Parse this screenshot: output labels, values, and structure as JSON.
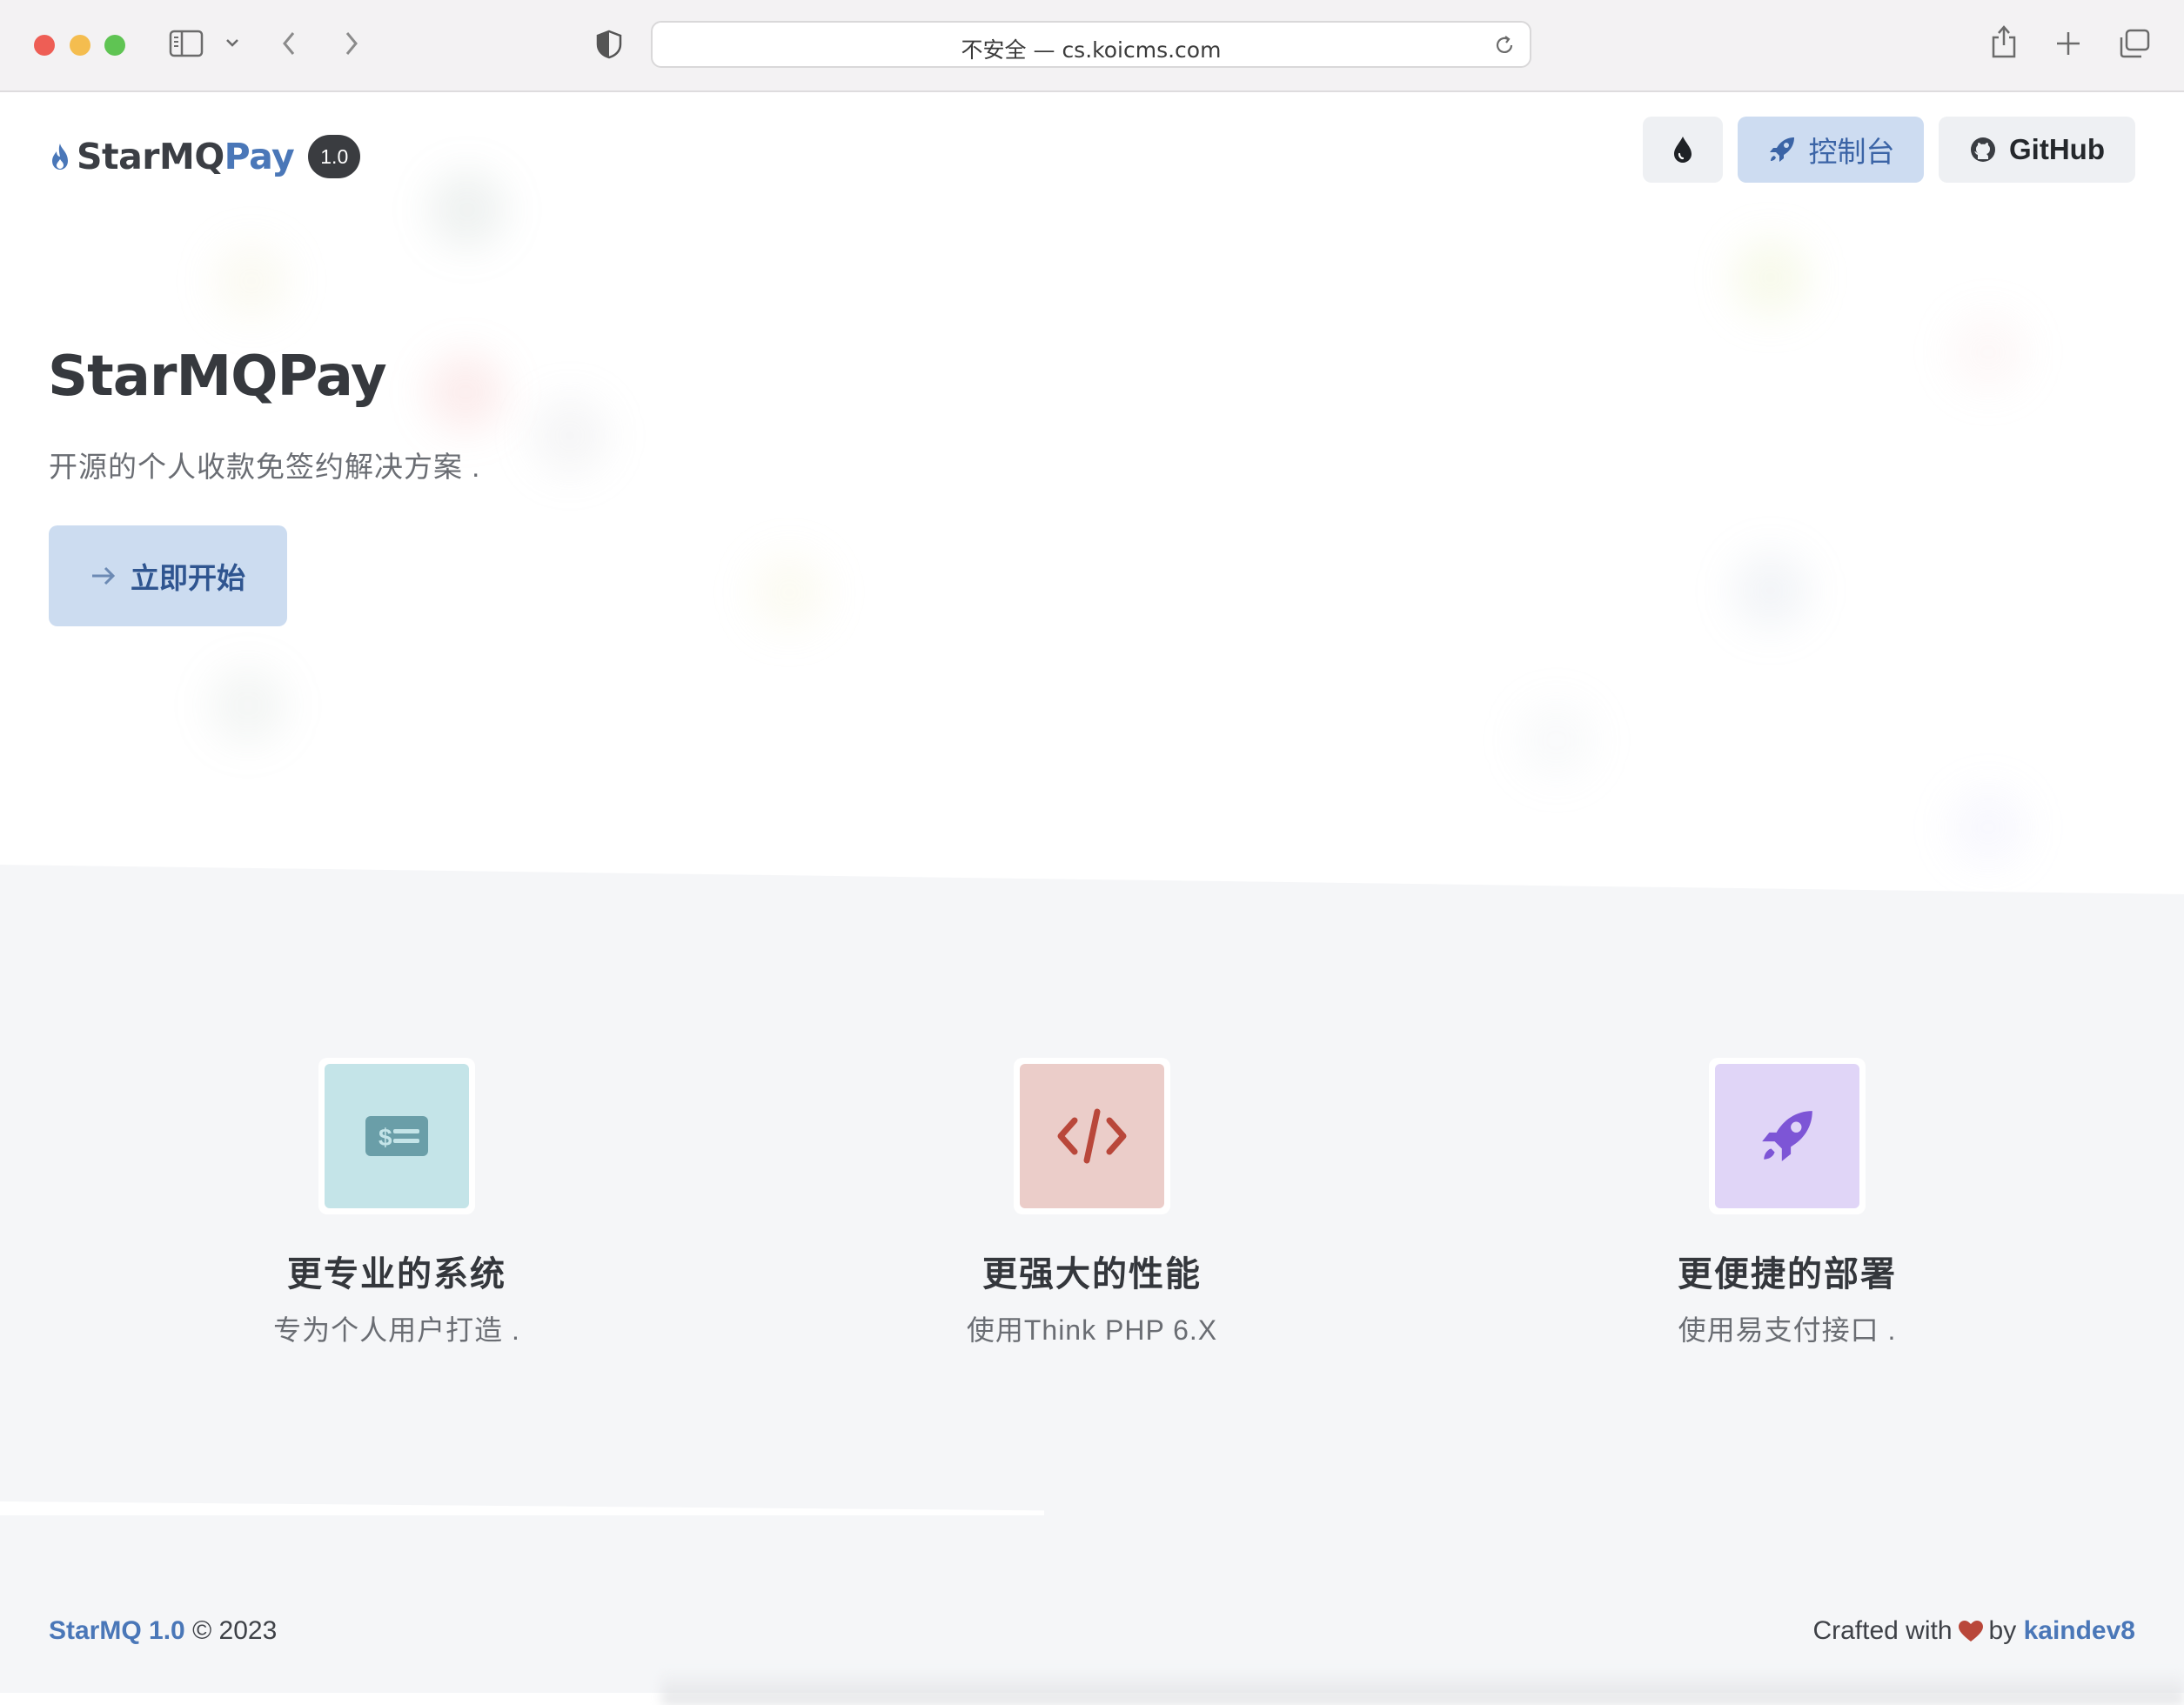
{
  "browser": {
    "url_display": "不安全 — cs.koicms.com"
  },
  "header": {
    "brand_main": "StarMQ",
    "brand_accent": "Pay",
    "version": "1.0",
    "nav": {
      "theme_icon": "droplet-icon",
      "console_label": "控制台",
      "github_label": "GitHub"
    }
  },
  "hero": {
    "title": "StarMQPay",
    "subtitle": "开源的个人收款免签约解决方案 .",
    "cta_label": "立即开始"
  },
  "features": [
    {
      "icon": "money-check-icon",
      "title": "更专业的系统",
      "desc": "专为个人用户打造 .",
      "tile_color": "#c4e4e8",
      "icon_color": "#6a9ea8"
    },
    {
      "icon": "code-icon",
      "title": "更强大的性能",
      "desc": "使用Think PHP 6.X",
      "tile_color": "#ebcdc9",
      "icon_color": "#b9473a"
    },
    {
      "icon": "rocket-icon",
      "title": "更便捷的部署",
      "desc": "使用易支付接口 .",
      "tile_color": "#e0d5f7",
      "icon_color": "#7d55d6"
    }
  ],
  "footer": {
    "brand": "StarMQ 1.0",
    "copyright": "© 2023",
    "crafted_prefix": "Crafted with",
    "crafted_by": "by",
    "author": "kaindev8"
  },
  "colors": {
    "accent": "#4a77b8",
    "console_bg": "#cddcf1",
    "heart": "#b9473a"
  }
}
